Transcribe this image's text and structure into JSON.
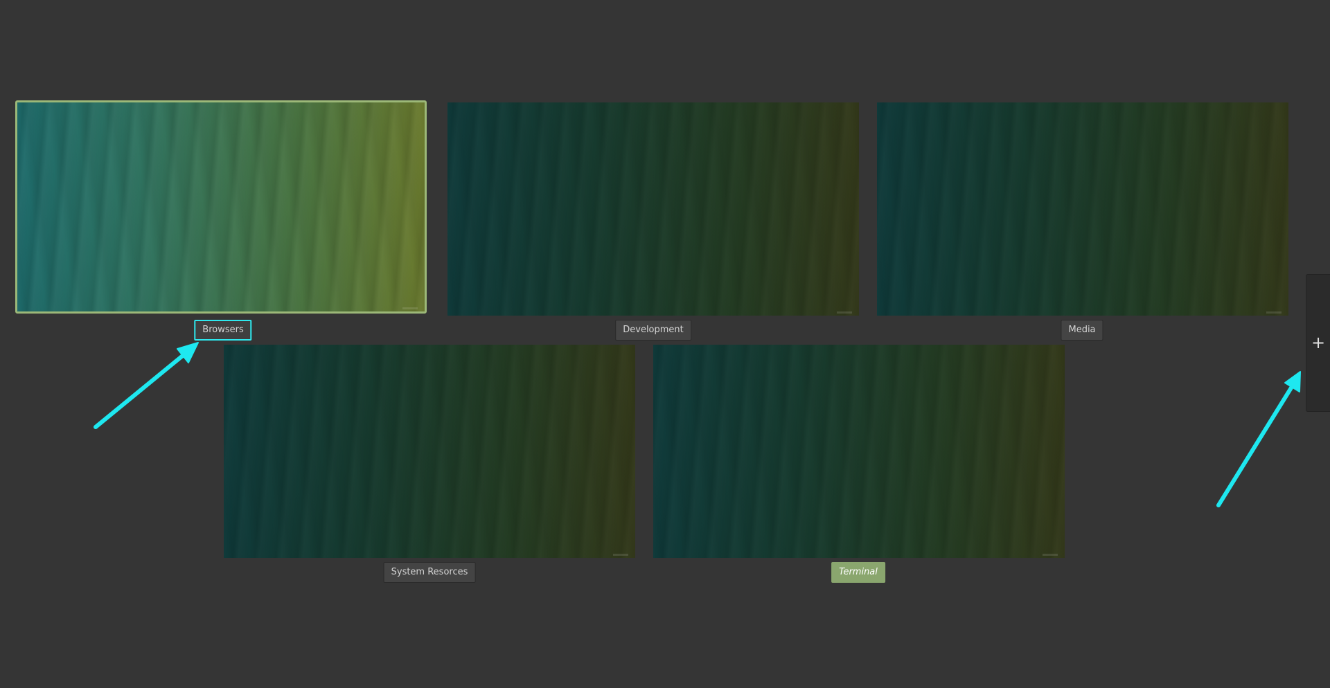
{
  "workspaces": [
    {
      "name": "Browsers",
      "active": true,
      "label_focused": true
    },
    {
      "name": "Development",
      "active": false
    },
    {
      "name": "Media",
      "active": false
    },
    {
      "name": "System Resorces",
      "active": false
    },
    {
      "name": "Terminal",
      "active": false,
      "current": true
    }
  ],
  "add_workspace": {
    "icon": "plus-icon",
    "glyph": "+"
  },
  "colors": {
    "background": "#353535",
    "active_border": "#9cb878",
    "focused_label_outline": "#2ee8ee",
    "current_label_bg": "#8aa66e",
    "annotation_arrow": "#1ee8f0"
  }
}
